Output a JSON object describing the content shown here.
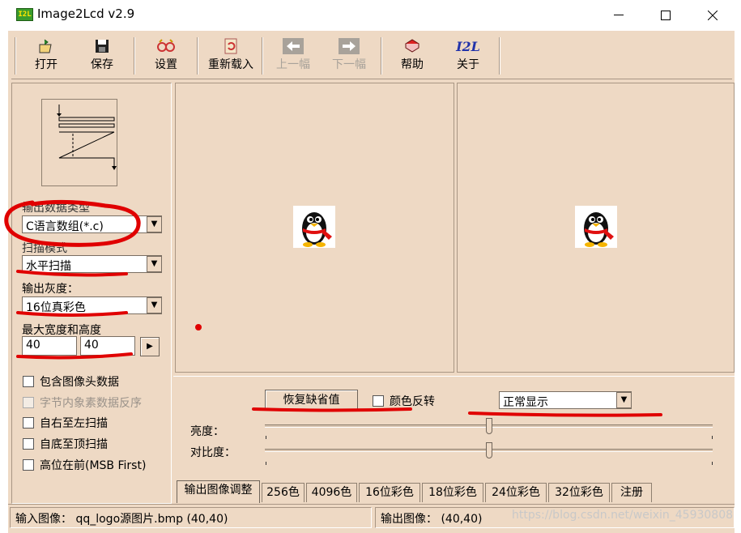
{
  "window": {
    "icon_text": "I2L",
    "title": "Image2Lcd v2.9",
    "minimize": "—",
    "maximize": "☐",
    "close": "✕"
  },
  "toolbar": {
    "items": [
      {
        "label": "打开",
        "icon": "open-icon",
        "glyph": "📂",
        "enabled": true
      },
      {
        "label": "保存",
        "icon": "save-icon",
        "glyph": "💾",
        "enabled": true
      },
      {
        "label": "设置",
        "icon": "settings-glasses-icon",
        "glyph": "👓",
        "enabled": true
      },
      {
        "label": "重新载入",
        "icon": "reload-icon",
        "glyph": "🔄",
        "enabled": true
      },
      {
        "label": "上一幅",
        "icon": "prev-arrow-icon",
        "glyph": "⇦",
        "enabled": false
      },
      {
        "label": "下一幅",
        "icon": "next-arrow-icon",
        "glyph": "⇨",
        "enabled": false
      },
      {
        "label": "帮助",
        "icon": "help-book-icon",
        "glyph": "📕",
        "enabled": true
      },
      {
        "label": "关于",
        "icon": "about-i2l-icon",
        "glyph": "I2L",
        "enabled": true
      }
    ]
  },
  "settings": {
    "output_type_label": "输出数据类型",
    "output_type_value": "C语言数组(*.c)",
    "scan_mode_label": "扫描模式",
    "scan_mode_value": "水平扫描",
    "gray_label": "输出灰度：",
    "gray_value": "16位真彩色",
    "size_label": "最大宽度和高度",
    "max_width": "40",
    "max_height": "40",
    "size_arrow": "▶",
    "checkboxes": [
      {
        "label": "包含图像头数据",
        "checked": false,
        "enabled": true
      },
      {
        "label": "字节内象素数据反序",
        "checked": false,
        "enabled": false
      },
      {
        "label": "自右至左扫描",
        "checked": false,
        "enabled": true
      },
      {
        "label": "自底至顶扫描",
        "checked": false,
        "enabled": true
      },
      {
        "label": "高位在前(MSB First)",
        "checked": false,
        "enabled": true
      }
    ]
  },
  "adjust": {
    "reset_button": "恢复缺省值",
    "invert_label": "颜色反转",
    "display_mode": "正常显示",
    "brightness_label": "亮度：",
    "contrast_label": "对比度：",
    "brightness": 0.5,
    "contrast": 0.5
  },
  "tabs": [
    "输出图像调整",
    "256色",
    "4096色",
    "16位彩色",
    "18位彩色",
    "24位彩色",
    "32位彩色",
    "注册"
  ],
  "status": {
    "input": "输入图像：  qq_logo源图片.bmp (40,40)",
    "output": "输出图像：  (40,40)",
    "watermark": "https://blog.csdn.net/weixin_45930808"
  },
  "colors": {
    "frame_bg": "#eed9c4",
    "annotation_red": "#e00000"
  }
}
